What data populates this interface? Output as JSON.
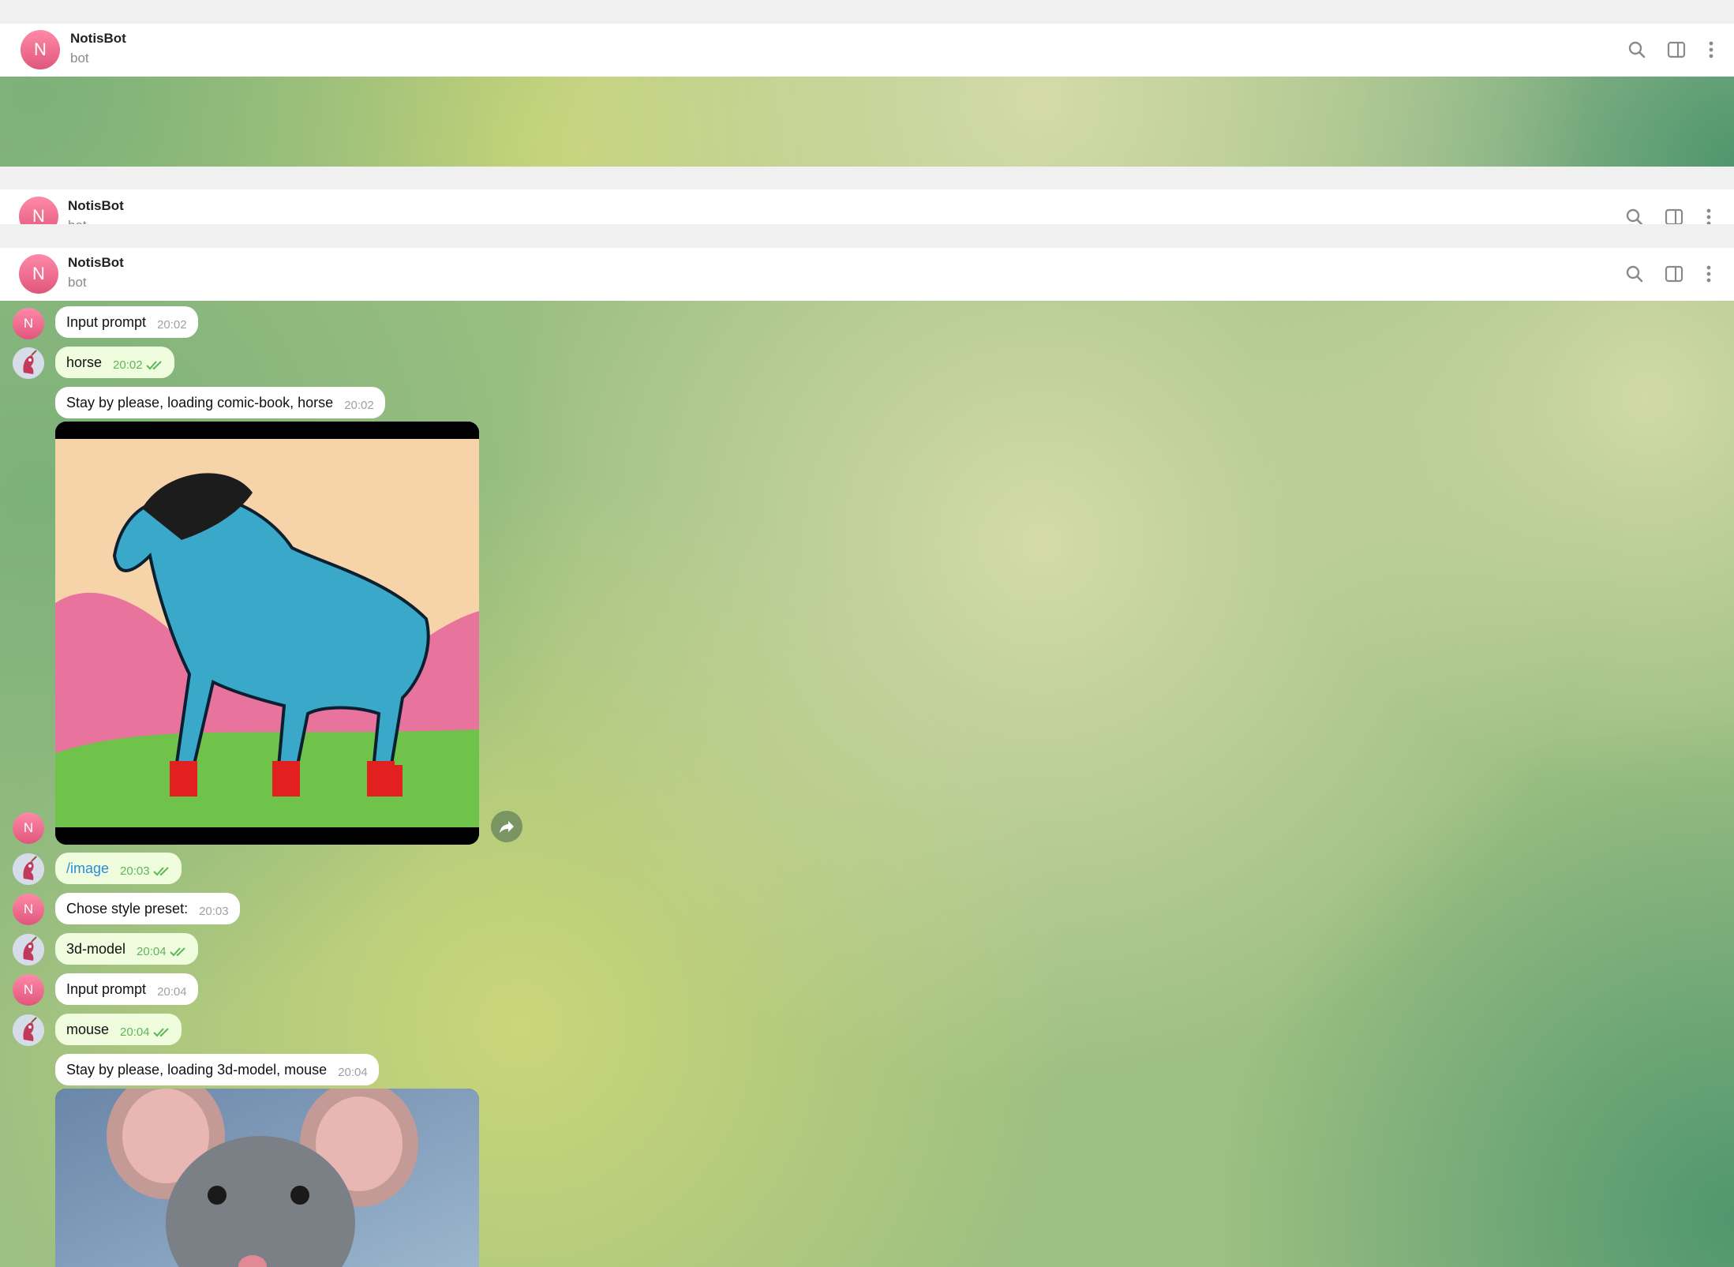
{
  "header": {
    "avatar_letter": "N",
    "title": "NotisBot",
    "subtitle": "bot",
    "icons": [
      "search-icon",
      "sidebar-toggle-icon",
      "more-vertical-icon"
    ]
  },
  "colors": {
    "avatar_pink": "#e0567c",
    "outgoing_bubble": "#effdde",
    "incoming_bubble": "#ffffff",
    "outgoing_time": "#5fb55a",
    "command_link": "#2a8cd9"
  },
  "messages": [
    {
      "sender": "bot",
      "text": "Input prompt",
      "time": "20:02"
    },
    {
      "sender": "user",
      "text": "horse",
      "time": "20:02",
      "status": "read"
    },
    {
      "sender": "bot",
      "text": "Stay by please, loading comic-book, horse",
      "time": "20:02"
    },
    {
      "sender": "bot",
      "type": "photo",
      "image": "comic-book horse"
    },
    {
      "sender": "user",
      "text": "/image",
      "time": "20:03",
      "status": "read"
    },
    {
      "sender": "bot",
      "text": "Chose style preset:",
      "time": "20:03"
    },
    {
      "sender": "user",
      "text": "3d-model",
      "time": "20:04",
      "status": "read"
    },
    {
      "sender": "bot",
      "text": "Input prompt",
      "time": "20:04"
    },
    {
      "sender": "user",
      "text": "mouse",
      "time": "20:04",
      "status": "read"
    },
    {
      "sender": "bot",
      "text": "Stay by please, loading 3d-model, mouse",
      "time": "20:04"
    },
    {
      "sender": "bot",
      "type": "photo",
      "image": "3d-model mouse"
    }
  ]
}
